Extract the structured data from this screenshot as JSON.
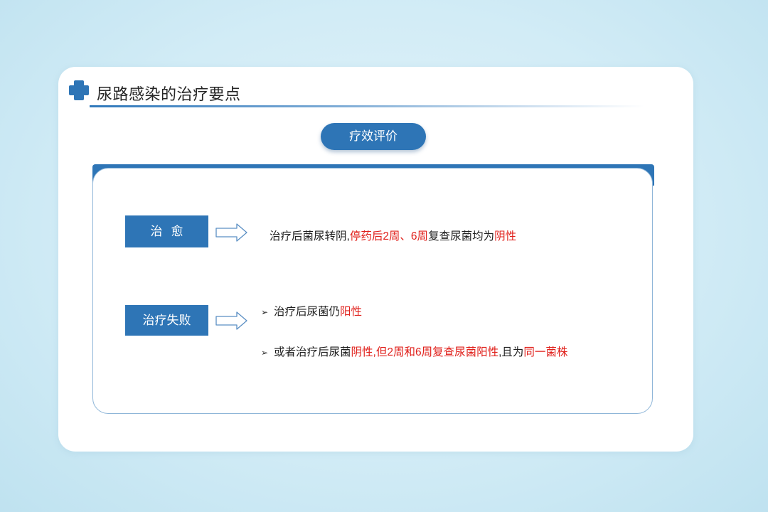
{
  "header": {
    "title": "尿路感染的治疗要点",
    "icon": "medical-cross-icon",
    "accent_color": "#2e75b6"
  },
  "section_pill": {
    "label": "疗效评价"
  },
  "rows": {
    "cure": {
      "label": "治愈",
      "text_parts": [
        "治疗后菌尿转阴,",
        "停药后2周、6周",
        "复查尿菌均为",
        "阴性"
      ]
    },
    "failure": {
      "label": "治疗失败",
      "bullet_1": [
        "治疗后尿菌仍",
        "阳性"
      ],
      "bullet_2": [
        "或者治疗后尿菌",
        "阴性,但2周和6周复查尿菌阳性",
        ",且为",
        "同一菌株"
      ]
    }
  },
  "colors": {
    "highlight": "#e0201b",
    "background": "#d2ecf6"
  }
}
